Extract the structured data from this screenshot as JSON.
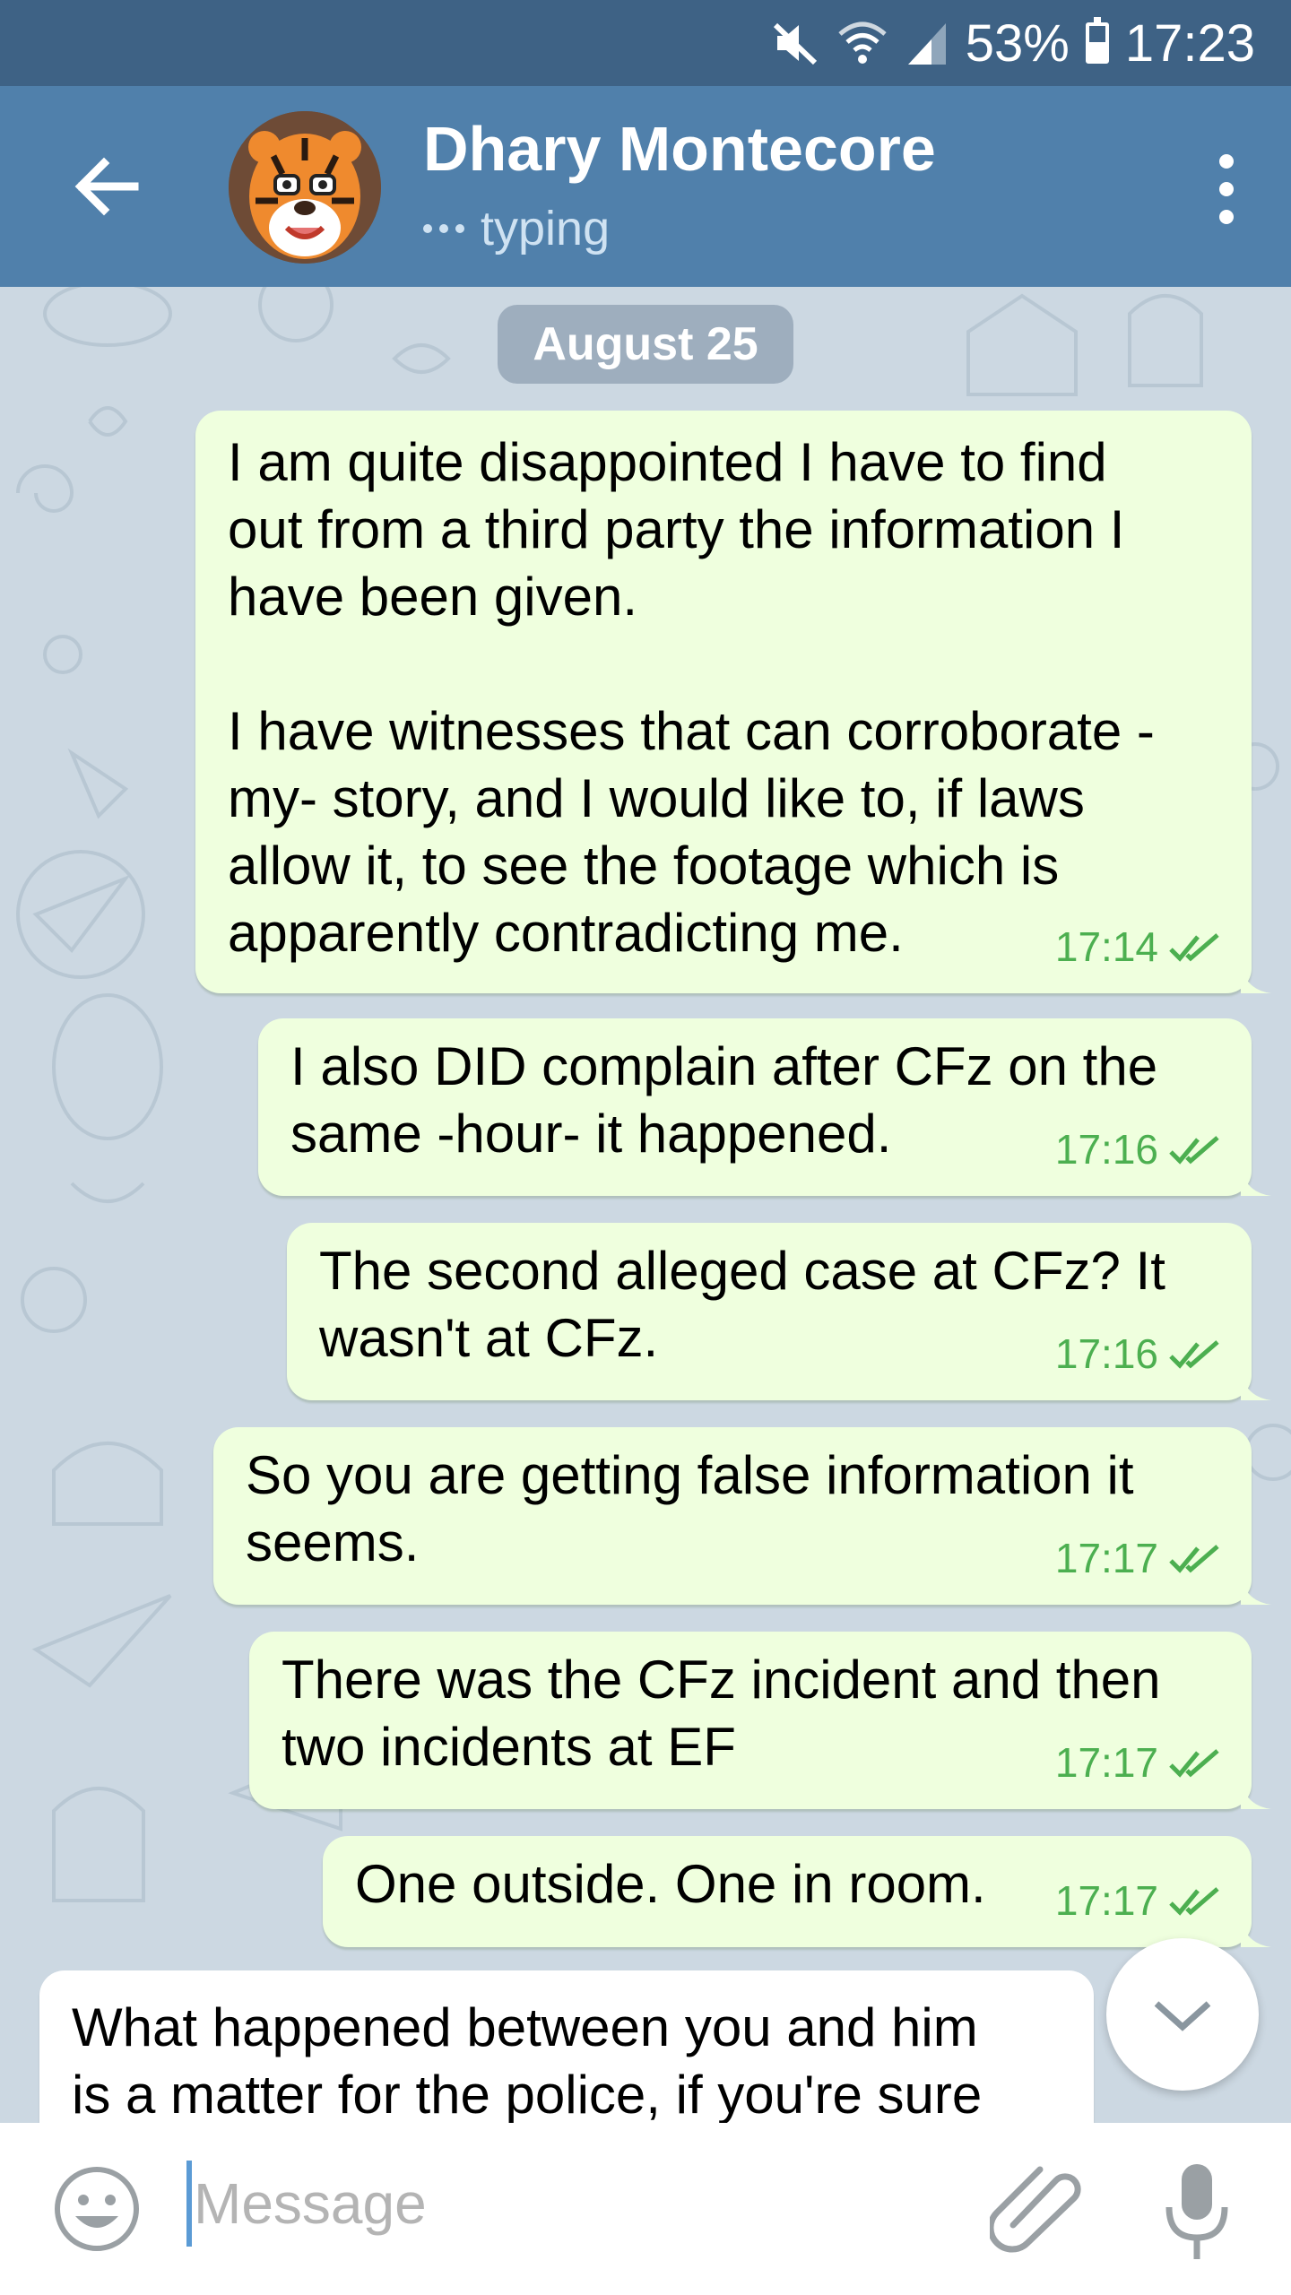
{
  "status_bar": {
    "battery_percent": "53%",
    "battery_level": 0.53,
    "time": "17:23",
    "icons": [
      "mute-icon",
      "wifi-icon",
      "signal-icon",
      "battery-icon"
    ]
  },
  "header": {
    "contact_name": "Dhary Montecore",
    "status": "typing",
    "icons": [
      "back-arrow-icon",
      "avatar",
      "more-vert-icon"
    ]
  },
  "chat": {
    "date_label": "August 25",
    "outgoing_messages": [
      {
        "text": "I am quite disappointed I have to find\nout from a third party the information I\nhave been given.\n\nI have witnesses that can corroborate -\nmy- story, and I would like to, if laws\nallow it, to see the footage which is\napparently contradicting me.",
        "time": "17:14",
        "status": "read"
      },
      {
        "text": "I also DID complain after CFz on the\nsame -hour- it happened.",
        "time": "17:16",
        "status": "read"
      },
      {
        "text": "The second alleged case at CFz? It\nwasn't at CFz.",
        "time": "17:16",
        "status": "read"
      },
      {
        "text": "So you are getting false information it\nseems.",
        "time": "17:17",
        "status": "read"
      },
      {
        "text": "There was the CFz incident and then\ntwo incidents at EF",
        "time": "17:17",
        "status": "read"
      },
      {
        "text": "One outside. One in room.",
        "time": "17:17",
        "status": "read"
      }
    ],
    "incoming_message": {
      "text": "What happened between you and him\nis a matter for the police, if you're sure"
    }
  },
  "input": {
    "placeholder": "Message",
    "value": ""
  },
  "colors": {
    "header": "#5080ab",
    "status_bar": "#3e6285",
    "outgoing_bubble": "#efffde",
    "check_green": "#4caf50"
  }
}
